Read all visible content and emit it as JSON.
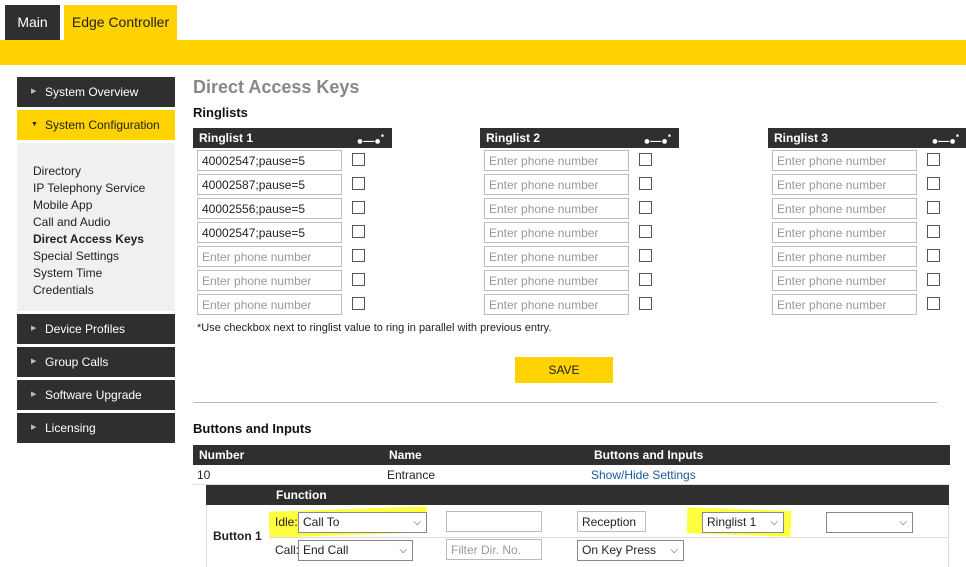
{
  "tabs": {
    "main": "Main",
    "edge": "Edge Controller"
  },
  "sidebar": {
    "items": [
      {
        "label": "System Overview"
      },
      {
        "label": "System Configuration"
      },
      {
        "label": "Device Profiles"
      },
      {
        "label": "Group Calls"
      },
      {
        "label": "Software Upgrade"
      },
      {
        "label": "Licensing"
      }
    ],
    "sub": [
      "Directory",
      "IP Telephony Service",
      "Mobile App",
      "Call and Audio",
      "Direct Access Keys",
      "Special Settings",
      "System Time",
      "Credentials"
    ]
  },
  "page": {
    "title": "Direct Access Keys",
    "ringlists_heading": "Ringlists",
    "buttons_heading": "Buttons and Inputs"
  },
  "ringlists": [
    {
      "title": "Ringlist 1",
      "values": [
        "40002547;pause=5",
        "40002587;pause=5",
        "40002556;pause=5",
        "40002547;pause=5",
        "",
        "",
        ""
      ]
    },
    {
      "title": "Ringlist 2",
      "values": [
        "",
        "",
        "",
        "",
        "",
        "",
        ""
      ]
    },
    {
      "title": "Ringlist 3",
      "values": [
        "",
        "",
        "",
        "",
        "",
        "",
        ""
      ]
    }
  ],
  "placeholder": "Enter phone number",
  "note": "*Use checkbox next to ringlist value to ring in parallel with previous entry.",
  "save_label": "SAVE",
  "table": {
    "headers": [
      "Number",
      "Name",
      "Buttons and Inputs"
    ],
    "row": {
      "number": "10",
      "name": "Entrance",
      "action": "Show/Hide Settings"
    }
  },
  "function": {
    "header": "Function",
    "button_label": "Button 1",
    "idle": {
      "label": "Idle:",
      "action": "Call To",
      "text": "",
      "value": "Reception",
      "ringlist": "Ringlist 1",
      "extra": ""
    },
    "call": {
      "label": "Call:",
      "action": "End Call",
      "placeholder": "Filter Dir. No.",
      "trigger": "On Key Press"
    }
  },
  "icons": {
    "parallel": "parallel-ring-icon",
    "arrow": "triangle-arrow-icon",
    "chevron": "chevron-down-icon"
  },
  "colors": {
    "accent": "#ffd200",
    "dark": "#2f2f2f",
    "highlight": "#ffff20"
  }
}
